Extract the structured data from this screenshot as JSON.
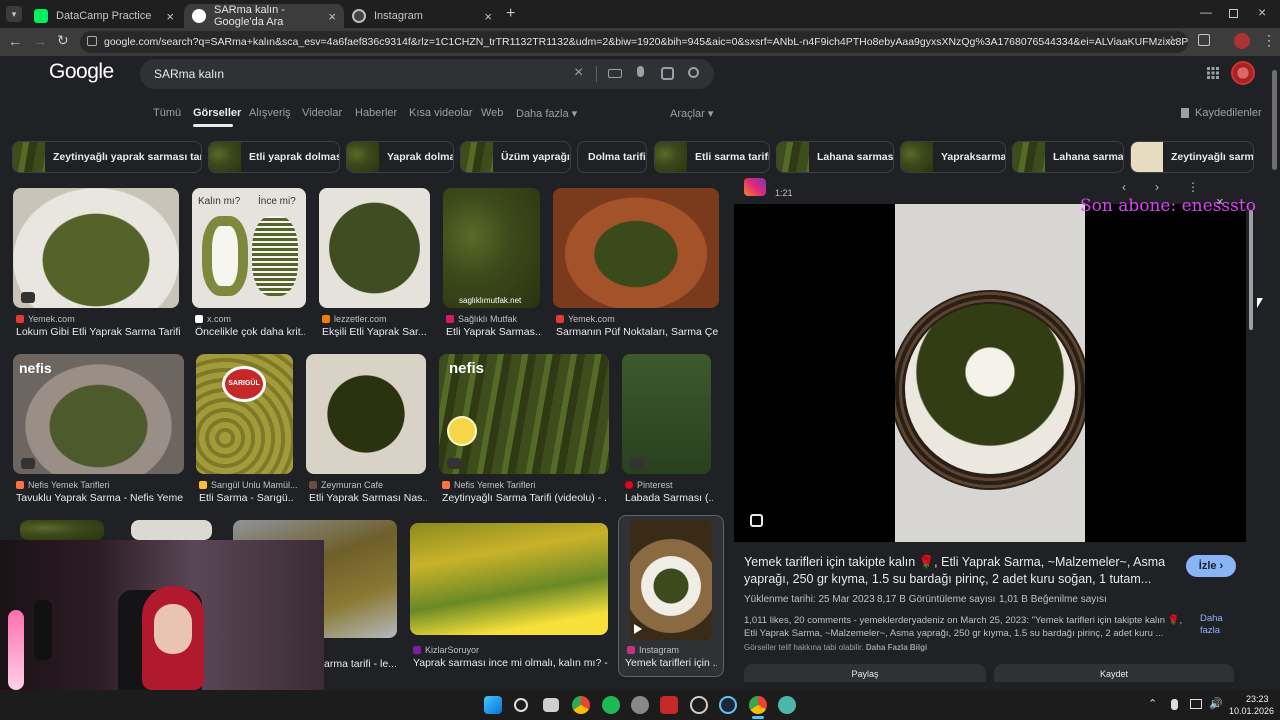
{
  "browser": {
    "tabs": [
      {
        "title": "DataCamp Practice",
        "color": "#03ef62"
      },
      {
        "title": "SARma kalın - Google'da Ara",
        "color": "#ffffff"
      },
      {
        "title": "Instagram",
        "color": "#ffffff"
      }
    ],
    "url": "google.com/search?q=SARma+kalın&sca_esv=4a6faef836c9314f&rlz=1C1CHZN_trTR1132TR1132&udm=2&biw=1920&bih=945&aic=0&sxsrf=ANbL-n4F9ich4PTHo8ebyAaa9gyxsXNzQg%3A1768076544334&ei=ALViaaKUFMzixc8PquOw8Q8&ved=0ahUK..."
  },
  "google": {
    "logo": "Google",
    "query": "SARma kalın",
    "nav": [
      "Tümü",
      "Görseller",
      "Alışveriş",
      "Videolar",
      "Haberler",
      "Kısa videolar",
      "Web",
      "Daha fazla"
    ],
    "active_nav": "Görseller",
    "tools": "Araçlar",
    "saved": "Kaydedilenler",
    "chips": [
      "Zeytinyağlı yaprak sarması tarifi",
      "Etli yaprak dolması",
      "Yaprak dolma",
      "Üzüm yaprağı",
      "Dolma tarifi",
      "Etli sarma tarifi",
      "Lahana sarması",
      "Yapraksarma",
      "Lahana sarma",
      "Zeytinyağlı sarma"
    ]
  },
  "results": [
    {
      "source": "Yemek.com",
      "caption": "Lokum Gibi Etli Yaprak Sarma Tarifi...",
      "color": "#e53935"
    },
    {
      "source": "x.com",
      "caption": "Öncelikle çok daha krit...",
      "color": "#ffffff",
      "overlay_left": "Kalın mı?",
      "overlay_right": "İnce mi?"
    },
    {
      "source": "lezzetler.com",
      "caption": "Ekşili Etli Yaprak Sar...",
      "color": "#f57c00"
    },
    {
      "source": "Sağlıklı Mutfak",
      "caption": "Etli Yaprak Sarmas...",
      "color": "#d81b60",
      "watermark": "saglıklımutfak.net"
    },
    {
      "source": "Yemek.com",
      "caption": "Sarmanın Püf Noktaları, Sarma Çe...",
      "color": "#e53935"
    },
    {
      "source": "Nefis Yemek Tarifleri",
      "caption": "Tavuklu Yaprak Sarma - Nefis Yeme...",
      "color": "#ff7043",
      "overlay": "nefis"
    },
    {
      "source": "Sarıgül Unlu Mamül...",
      "caption": "Etli Sarma - Sarıgü...",
      "color": "#fbc02d",
      "overlay": "SARIGÜL"
    },
    {
      "source": "Zeymuran Cafe",
      "caption": "Etli Yaprak Sarması Nas...",
      "color": "#6d4c41"
    },
    {
      "source": "Nefis Yemek Tarifleri",
      "caption": "Zeytinyağlı Sarma Tarifi (videolu) - ...",
      "color": "#ff7043",
      "overlay": "nefis"
    },
    {
      "source": "Pinterest",
      "caption": "Labada Sarması (...",
      "color": "#e60023"
    },
    {
      "source": "KizlarSoruyor",
      "caption": "Yaprak sarması ince mi olmalı, kalın mı? - ...",
      "color": "#7b1fa2"
    },
    {
      "source": "Instagram",
      "caption": "Yemek tarifleri için ...",
      "color": "#c13584"
    },
    {
      "source": "",
      "caption": "arma tarifi - le...",
      "color": "#888"
    }
  ],
  "preview": {
    "duration": "1:21",
    "title": "Yemek tarifleri için takipte kalın 🌹, Etli Yaprak Sarma, ~Malzemeler~, Asma yaprağı, 250 gr kıyma, 1.5 su bardağı pirinç, 2 adet kuru soğan, 1 tutam...",
    "watch": "İzle",
    "meta": [
      "Yüklenme tarihi: 25 Mar 2023",
      "8,17 B Görüntüleme sayısı",
      "1,01 B Beğenilme sayısı"
    ],
    "description": "1,011 likes, 20 comments - yemeklerderyadeniz on March 25, 2023: \"Yemek tarifleri için takipte kalın 🌹, Etli Yaprak Sarma, ~Malzemeler~, Asma yaprağı, 250 gr kıyma, 1.5 su bardağı pirinç, 2 adet kuru ...",
    "more": "Daha fazla",
    "copyright": "Görseller telif hakkına tabi olabilir.",
    "learn_more": "Daha Fazla Bilgi",
    "btn_share": "Paylaş",
    "btn_save": "Kaydet"
  },
  "overlay_text": "Son abone: enesssto",
  "taskbar": {
    "time": "23:23",
    "date": "10.01.2026"
  }
}
